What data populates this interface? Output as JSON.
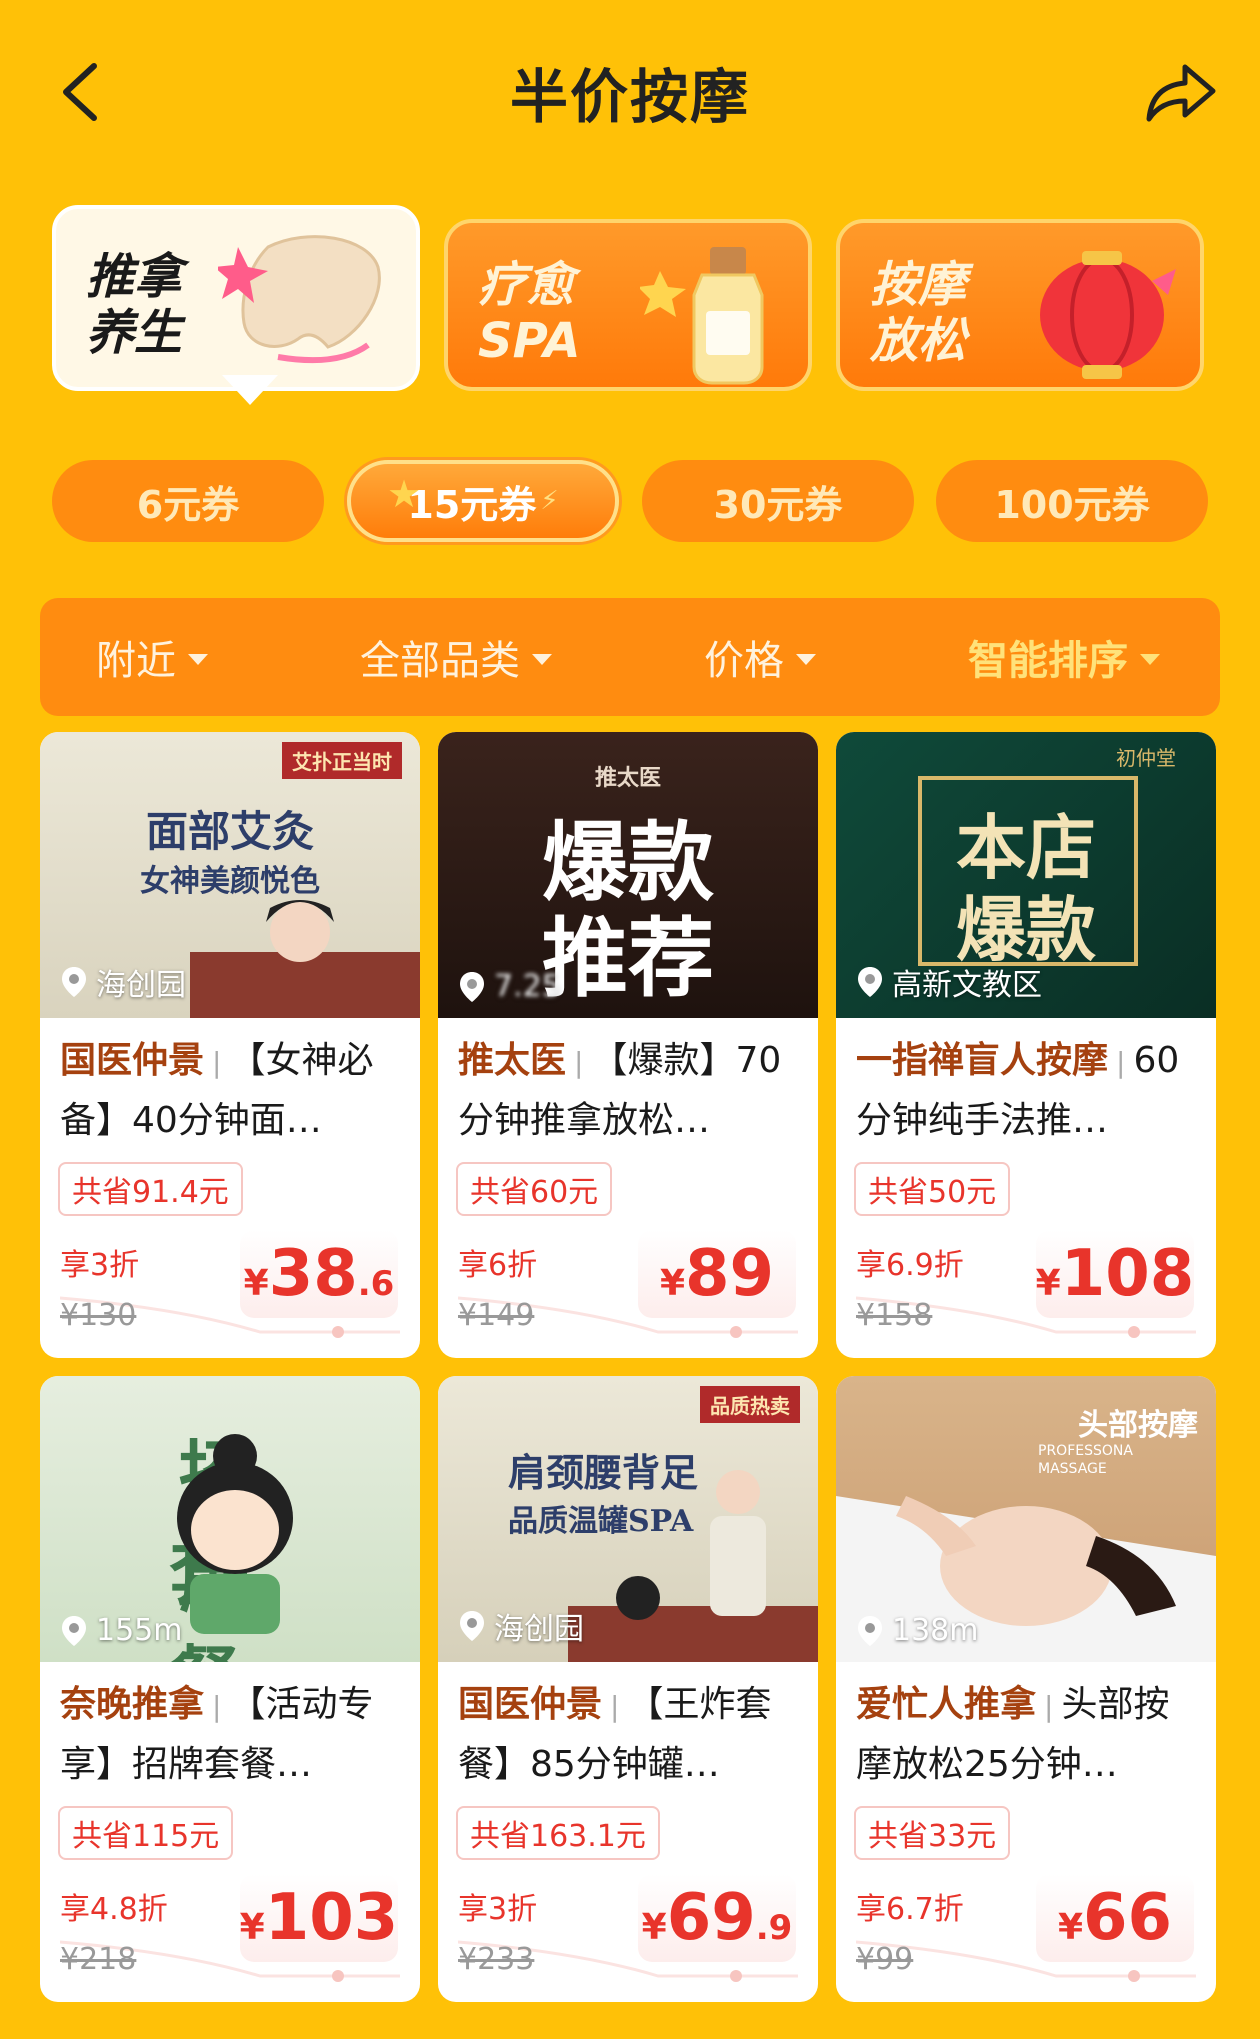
{
  "header": {
    "title": "半价按摩",
    "back_icon": "chevron-left-icon",
    "share_icon": "share-icon"
  },
  "categories": [
    {
      "label_line1": "推拿",
      "label_line2": "养生",
      "active": true
    },
    {
      "label_line1": "疗愈",
      "label_line2": "SPA",
      "active": false
    },
    {
      "label_line1": "按摩",
      "label_line2": "放松",
      "active": false
    }
  ],
  "coupons": [
    {
      "label": "6元券",
      "active": false
    },
    {
      "label": "15元券",
      "active": true
    },
    {
      "label": "30元券",
      "active": false
    },
    {
      "label": "100元券",
      "active": false
    }
  ],
  "filters": [
    {
      "label": "附近",
      "active": false
    },
    {
      "label": "全部品类",
      "active": false
    },
    {
      "label": "价格",
      "active": false
    },
    {
      "label": "智能排序",
      "active": true
    }
  ],
  "products": [
    {
      "img_line1": "面部艾灸",
      "img_line2": "女神美颜悦色",
      "img_badge": "艾扑正当时",
      "location": "海创园",
      "shop": "国医仲景",
      "title": "【女神必备】40分钟面…",
      "save": "共省91.4元",
      "discount": "享3折",
      "currency": "¥",
      "price_int": "38",
      "price_dec": ".6",
      "original": "¥130"
    },
    {
      "img_line1": "爆款",
      "img_line2": "推荐",
      "img_badge": "推太医",
      "location": "7.25",
      "shop": "推太医",
      "title": "【爆款】70分钟推拿放松…",
      "save": "共省60元",
      "discount": "享6折",
      "currency": "¥",
      "price_int": "89",
      "price_dec": "",
      "original": "¥149"
    },
    {
      "img_line1": "本店",
      "img_line2": "爆款",
      "img_badge": "初仲堂",
      "location": "高新文教区",
      "shop": "一指禅盲人按摩",
      "title": "60分钟纯手法推…",
      "save": "共省50元",
      "discount": "享6.9折",
      "currency": "¥",
      "price_int": "108",
      "price_dec": "",
      "original": "¥158"
    },
    {
      "img_line1": "招牌",
      "img_line2": "套餐",
      "img_badge": "",
      "location": "155m",
      "shop": "奈晚推拿",
      "title": "【活动专享】招牌套餐…",
      "save": "共省115元",
      "discount": "享4.8折",
      "currency": "¥",
      "price_int": "103",
      "price_dec": "",
      "original": "¥218"
    },
    {
      "img_line1": "肩颈腰背足",
      "img_line2": "品质温罐SPA",
      "img_badge": "品质热卖",
      "location": "海创园",
      "shop": "国医仲景",
      "title": "【王炸套餐】85分钟罐…",
      "save": "共省163.1元",
      "discount": "享3折",
      "currency": "¥",
      "price_int": "69",
      "price_dec": ".9",
      "original": "¥233"
    },
    {
      "img_line1": "头部按摩",
      "img_line2": "PROFESSONA MASSAGE",
      "img_badge": "",
      "location": "138m",
      "shop": "爱忙人推拿",
      "title": "头部按摩放松25分钟…",
      "save": "共省33元",
      "discount": "享6.7折",
      "currency": "¥",
      "price_int": "66",
      "price_dec": "",
      "original": "¥99"
    }
  ],
  "colors": {
    "background": "#FFC107",
    "accent": "#FF8C10",
    "price": "#E8342B",
    "shop": "#A5410F"
  }
}
